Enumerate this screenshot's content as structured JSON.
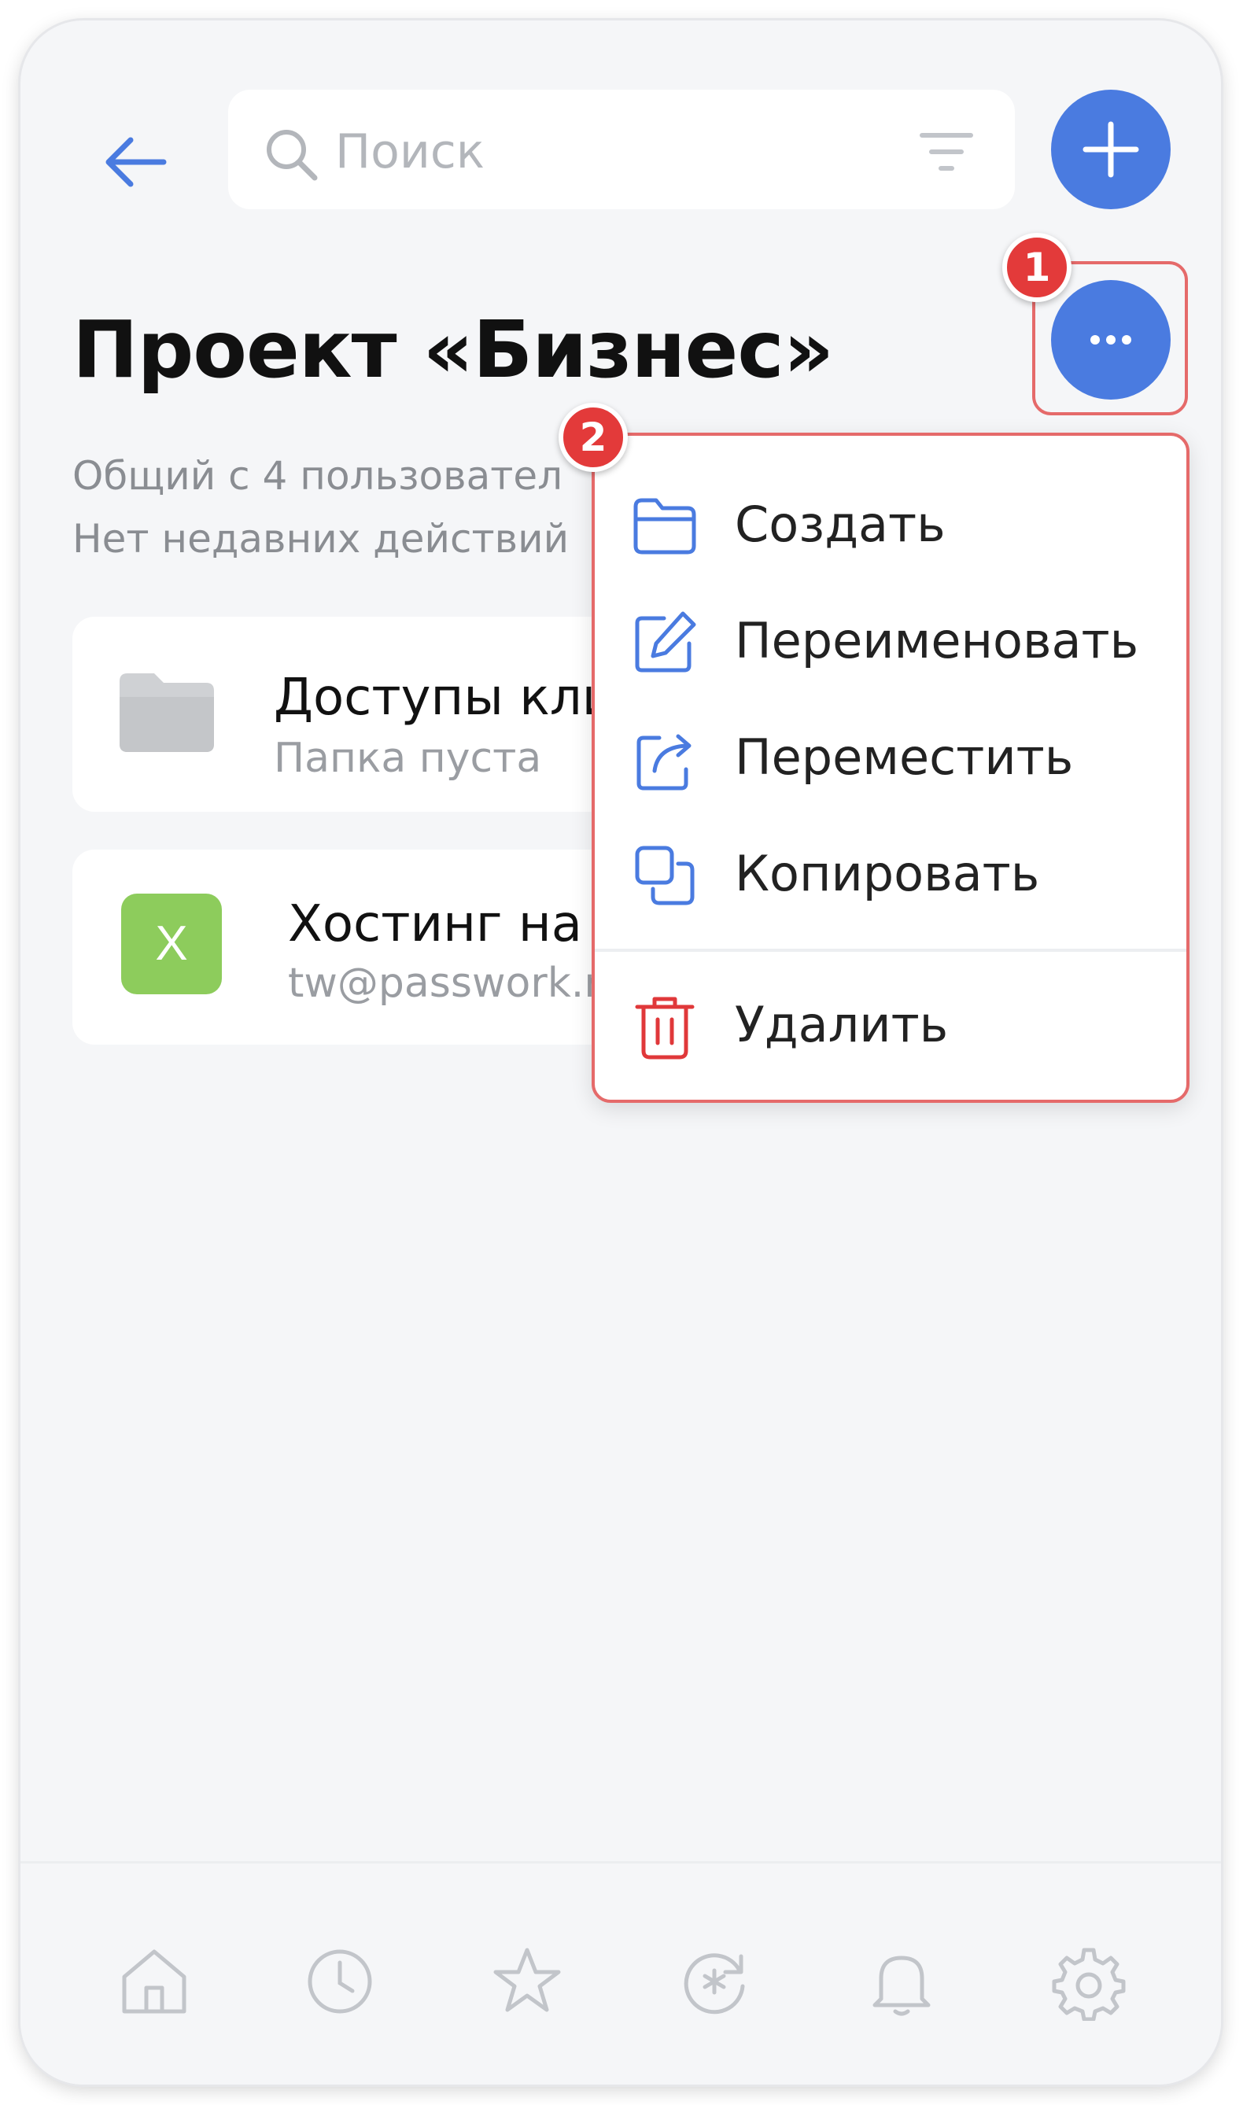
{
  "search": {
    "placeholder": "Поиск"
  },
  "header": {
    "title": "Проект «Бизнес»",
    "shared_text": "Общий с 4 пользовател",
    "activity_text": "Нет недавних действий"
  },
  "items": [
    {
      "type": "folder",
      "title": "Доступы клие",
      "subtitle": "Папка пуста",
      "icon": "folder-icon"
    },
    {
      "type": "password",
      "title": "Хостинг на Fo",
      "subtitle": "tw@passwork.ru",
      "avatar_letter": "X",
      "avatar_color": "#8dcc5c"
    }
  ],
  "menu": {
    "items": [
      {
        "label": "Создать",
        "icon": "folder-icon"
      },
      {
        "label": "Переименовать",
        "icon": "edit-icon"
      },
      {
        "label": "Переместить",
        "icon": "move-icon"
      },
      {
        "label": "Копировать",
        "icon": "copy-icon"
      },
      {
        "label": "Удалить",
        "icon": "trash-icon"
      }
    ]
  },
  "annotations": {
    "badge_1": "1",
    "badge_2": "2"
  },
  "bottom_nav": [
    "home-icon",
    "clock-icon",
    "star-icon",
    "generator-icon",
    "bell-icon",
    "gear-icon"
  ],
  "colors": {
    "accent": "#4a7be0",
    "danger": "#e0383a",
    "highlight": "#e56a6a",
    "background": "#f5f6f8"
  }
}
